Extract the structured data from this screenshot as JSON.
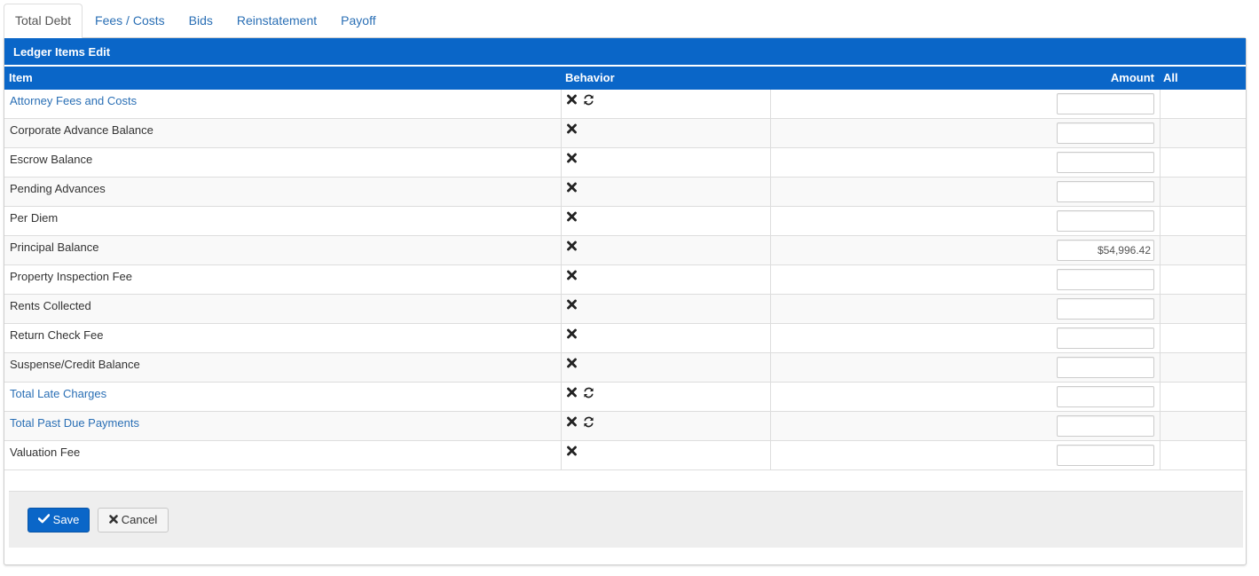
{
  "tabs": [
    {
      "label": "Total Debt",
      "active": true
    },
    {
      "label": "Fees / Costs",
      "active": false
    },
    {
      "label": "Bids",
      "active": false
    },
    {
      "label": "Reinstatement",
      "active": false
    },
    {
      "label": "Payoff",
      "active": false
    }
  ],
  "panel": {
    "title": "Ledger Items Edit",
    "columns": {
      "item": "Item",
      "behavior": "Behavior",
      "amount": "Amount",
      "all": "All"
    }
  },
  "rows": [
    {
      "item": "Attorney Fees and Costs",
      "link": true,
      "icons": [
        "remove-icon",
        "refresh-icon"
      ],
      "amount": ""
    },
    {
      "item": "Corporate Advance Balance",
      "link": false,
      "icons": [
        "remove-icon"
      ],
      "amount": ""
    },
    {
      "item": "Escrow Balance",
      "link": false,
      "icons": [
        "remove-icon"
      ],
      "amount": ""
    },
    {
      "item": "Pending Advances",
      "link": false,
      "icons": [
        "remove-icon"
      ],
      "amount": ""
    },
    {
      "item": "Per Diem",
      "link": false,
      "icons": [
        "remove-icon"
      ],
      "amount": ""
    },
    {
      "item": "Principal Balance",
      "link": false,
      "icons": [
        "remove-icon"
      ],
      "amount": "$54,996.42"
    },
    {
      "item": "Property Inspection Fee",
      "link": false,
      "icons": [
        "remove-icon"
      ],
      "amount": ""
    },
    {
      "item": "Rents Collected",
      "link": false,
      "icons": [
        "remove-icon"
      ],
      "amount": ""
    },
    {
      "item": "Return Check Fee",
      "link": false,
      "icons": [
        "remove-icon"
      ],
      "amount": ""
    },
    {
      "item": "Suspense/Credit Balance",
      "link": false,
      "icons": [
        "remove-icon"
      ],
      "amount": ""
    },
    {
      "item": "Total Late Charges",
      "link": true,
      "icons": [
        "remove-icon",
        "refresh-icon"
      ],
      "amount": ""
    },
    {
      "item": "Total Past Due Payments",
      "link": true,
      "icons": [
        "remove-icon",
        "refresh-icon"
      ],
      "amount": ""
    },
    {
      "item": "Valuation Fee",
      "link": false,
      "icons": [
        "remove-icon"
      ],
      "amount": ""
    }
  ],
  "footer": {
    "save_label": "Save",
    "save_icon": "check-icon",
    "cancel_label": "Cancel",
    "cancel_icon": "remove-icon"
  },
  "colors": {
    "accent": "#0a66c8",
    "link": "#2a6fb5"
  }
}
